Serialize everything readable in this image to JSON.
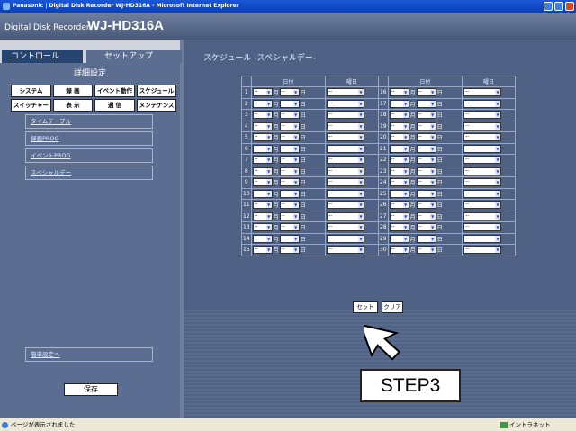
{
  "window": {
    "title": "Panasonic | Digital Disk Recorder WJ-HD316A - Microsoft Internet Explorer"
  },
  "header": {
    "product_type": "Digital Disk Recorder",
    "model": "WJ-HD316A"
  },
  "tabs": {
    "control": "コントロール",
    "setup": "セットアップ"
  },
  "left": {
    "section_title": "詳細設定",
    "categories_row1": [
      "システム",
      "録 画",
      "イベント動作",
      "スケジュール"
    ],
    "categories_row2": [
      "スイッチャー",
      "表 示",
      "通 信",
      "メンテナンス"
    ],
    "nav": [
      "タイムテーブル",
      "録画PROG",
      "イベントPROG",
      "スペシャルデー"
    ],
    "easy_link": "簡単設定へ",
    "save": "保存"
  },
  "main": {
    "title": "スケジュール -スペシャルデー-",
    "headers": {
      "date": "日付",
      "weekday": "曜日"
    },
    "month_unit": "月",
    "day_unit": "日",
    "placeholder": "--",
    "rows_left": [
      "1",
      "2",
      "3",
      "4",
      "5",
      "6",
      "7",
      "8",
      "9",
      "10",
      "11",
      "12",
      "13",
      "14",
      "15"
    ],
    "rows_right": [
      "16",
      "17",
      "18",
      "19",
      "20",
      "21",
      "22",
      "23",
      "24",
      "25",
      "26",
      "27",
      "28",
      "29",
      "30"
    ],
    "set_button": "セット",
    "clear_button": "クリア"
  },
  "annotation": {
    "step": "STEP3"
  },
  "status": {
    "left": "ページが表示されました",
    "right": "イントラネット"
  }
}
